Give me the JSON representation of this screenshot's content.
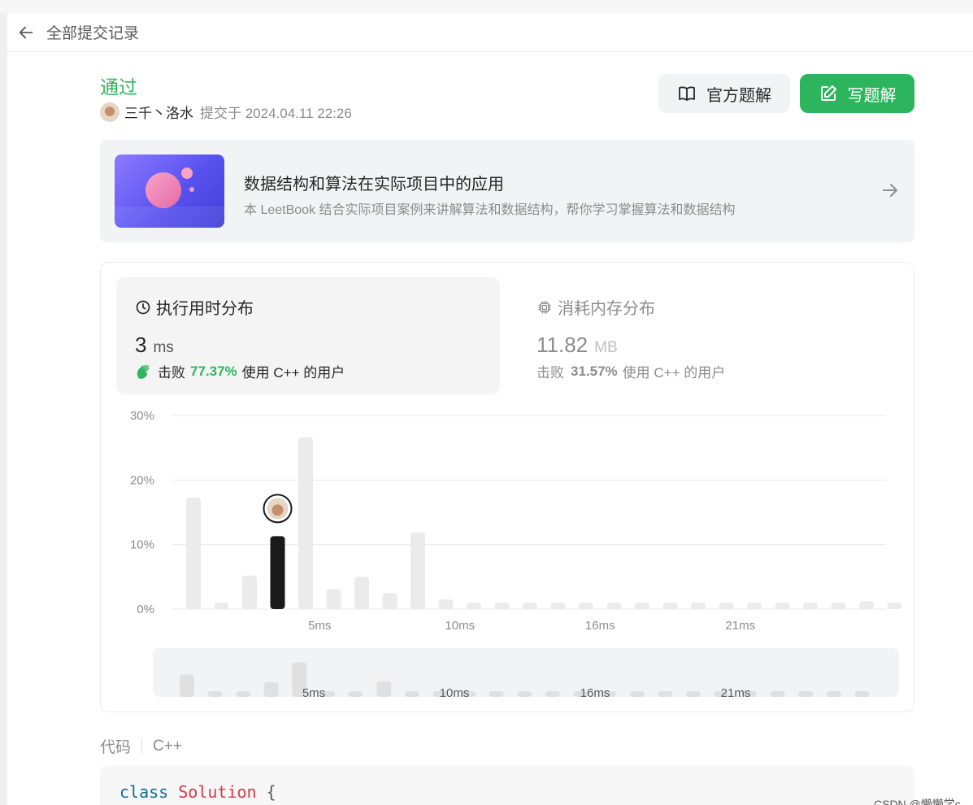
{
  "header": {
    "back_label": "全部提交记录"
  },
  "submission": {
    "status": "通过",
    "user": "三千丶洛水",
    "submitted_at": "提交于 2024.04.11 22:26"
  },
  "buttons": {
    "official": "官方题解",
    "write": "写题解"
  },
  "banner": {
    "title": "数据结构和算法在实际项目中的应用",
    "desc": "本 LeetBook 结合实际项目案例来讲解算法和数据结构，帮你学习掌握算法和数据结构"
  },
  "runtime": {
    "title": "执行用时分布",
    "value": "3",
    "unit": "ms",
    "beat_prefix": "击败",
    "beat_pct": "77.37%",
    "beat_suffix": "使用 C++ 的用户"
  },
  "memory": {
    "title": "消耗内存分布",
    "value": "11.82",
    "unit": "MB",
    "beat_prefix": "击败",
    "beat_pct": "31.57%",
    "beat_suffix": "使用 C++ 的用户"
  },
  "chart_data": {
    "type": "bar",
    "y_tick_labels": [
      "0%",
      "10%",
      "20%",
      "30%"
    ],
    "ylim": [
      0,
      30
    ],
    "x_tick_labels": [
      {
        "label": "5ms",
        "index": 5
      },
      {
        "label": "10ms",
        "index": 10
      },
      {
        "label": "16ms",
        "index": 15
      },
      {
        "label": "21ms",
        "index": 20
      }
    ],
    "values": [
      17.3,
      1.0,
      5.2,
      11.3,
      26.6,
      3.1,
      5.0,
      2.5,
      11.9,
      1.5,
      1.0,
      1.0,
      1.0,
      1.0,
      1.0,
      1.0,
      1.0,
      1.0,
      1.0,
      1.0,
      1.0,
      1.0,
      1.0,
      1.0,
      1.2,
      1.0
    ],
    "highlight_index": 3,
    "colors": {
      "bar": "#ebebeb",
      "highlight": "#1a1a1a",
      "grid": "#e8e8e8",
      "mini_bg": "#f2f3f5",
      "mini_bar": "#e0e0e0"
    },
    "mini_values": [
      17.3,
      1.0,
      1.0,
      11.3,
      26.6,
      1.0,
      1.0,
      11.9,
      1.0,
      1.0,
      1.0,
      1.0,
      1.0,
      1.0,
      1.0,
      1.0,
      1.0,
      1.0,
      1.0,
      1.0,
      1.0,
      1.0,
      1.0,
      1.0,
      1.0
    ]
  },
  "code": {
    "label": "代码",
    "lang": "C++",
    "line1": {
      "kw": "class",
      "name": "Solution",
      "brace": "{"
    }
  },
  "watermark": "CSDN @懒懒学c"
}
